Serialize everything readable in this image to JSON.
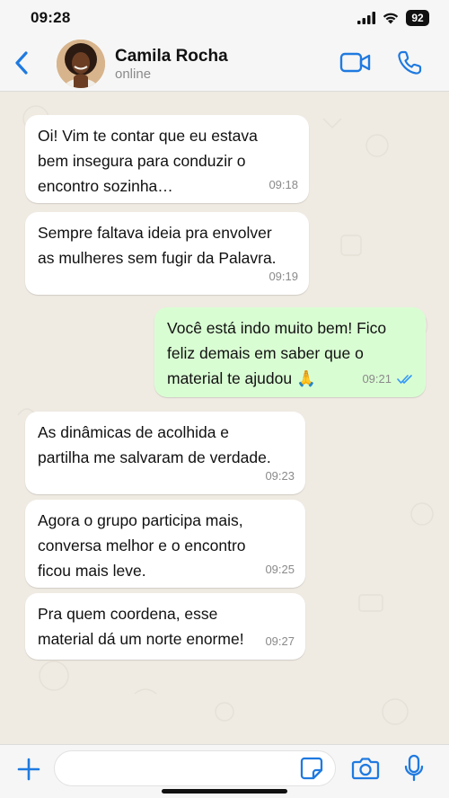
{
  "status_bar": {
    "time": "09:28",
    "battery": "92"
  },
  "contact": {
    "name": "Camila Rocha",
    "status": "online"
  },
  "messages": [
    {
      "direction": "in",
      "lines": [
        "Oi! Vim te contar que eu estava",
        "bem insegura para conduzir o",
        "encontro sozinha…"
      ],
      "time": "09:18"
    },
    {
      "direction": "in",
      "lines": [
        "Sempre faltava ideia pra envolver",
        "as mulheres sem fugir da Palavra."
      ],
      "time": "09:19"
    },
    {
      "direction": "out",
      "lines": [
        "Você está indo muito bem! Fico",
        "feliz demais em saber que o",
        "material te ajudou 🙏"
      ],
      "time": "09:21",
      "read": true
    },
    {
      "direction": "in",
      "lines": [
        "As dinâmicas de acolhida e",
        "partilha me salvaram de verdade."
      ],
      "time": "09:23"
    },
    {
      "direction": "in",
      "lines": [
        "Agora o grupo participa mais,",
        "conversa melhor e o encontro",
        "ficou mais leve."
      ],
      "time": "09:25"
    },
    {
      "direction": "in",
      "lines": [
        "Pra quem coordena, esse",
        "material dá um norte enorme!"
      ],
      "time": "09:27"
    }
  ],
  "input": {
    "placeholder": ""
  },
  "colors": {
    "accent": "#1f7ae0",
    "outgoing_bubble": "#d9fdd3",
    "read_tick": "#3497f9"
  },
  "icons": [
    "back-chevron-icon",
    "video-camera-icon",
    "phone-icon",
    "plus-icon",
    "sticker-icon",
    "camera-icon",
    "microphone-icon"
  ]
}
